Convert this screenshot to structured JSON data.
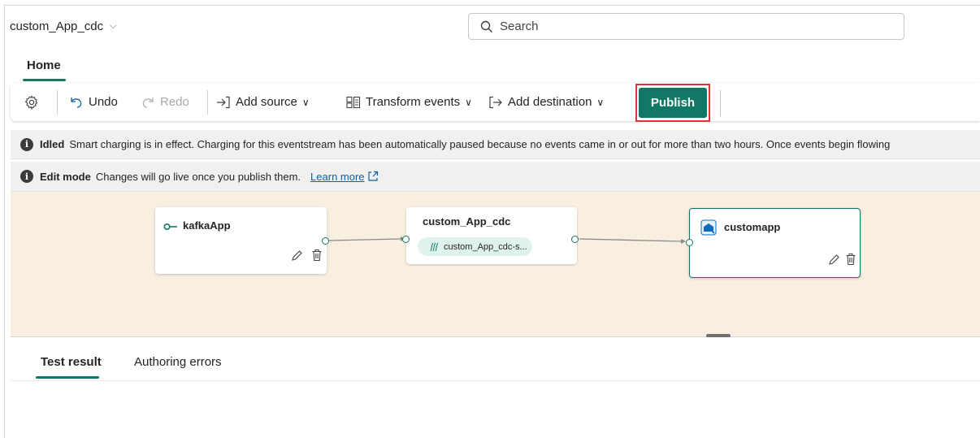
{
  "header": {
    "app_title": "custom_App_cdc",
    "search_placeholder": "Search"
  },
  "ribbon": {
    "tab": "Home"
  },
  "toolbar": {
    "undo": "Undo",
    "redo": "Redo",
    "add_source": "Add source",
    "transform_events": "Transform events",
    "add_destination": "Add destination",
    "publish": "Publish"
  },
  "notices": {
    "idled_title": "Idled",
    "idled_text": "Smart charging is in effect. Charging for this eventstream has been automatically paused because no events came in or out for more than two hours. Once events begin flowing",
    "edit_title": "Edit mode",
    "edit_text": "Changes will go live once you publish them.",
    "learn_more": "Learn more"
  },
  "canvas": {
    "source_node": {
      "title": "kafkaApp"
    },
    "stream_node": {
      "title": "custom_App_cdc",
      "stream_label": "custom_App_cdc-s..."
    },
    "dest_node": {
      "title": "customapp"
    }
  },
  "bottom_panel": {
    "tabs": [
      "Test result",
      "Authoring errors"
    ],
    "active_tab": "Test result"
  },
  "colors": {
    "accent": "#117865",
    "highlight_outline": "#e0343a",
    "canvas_bg": "#f8efe1"
  }
}
